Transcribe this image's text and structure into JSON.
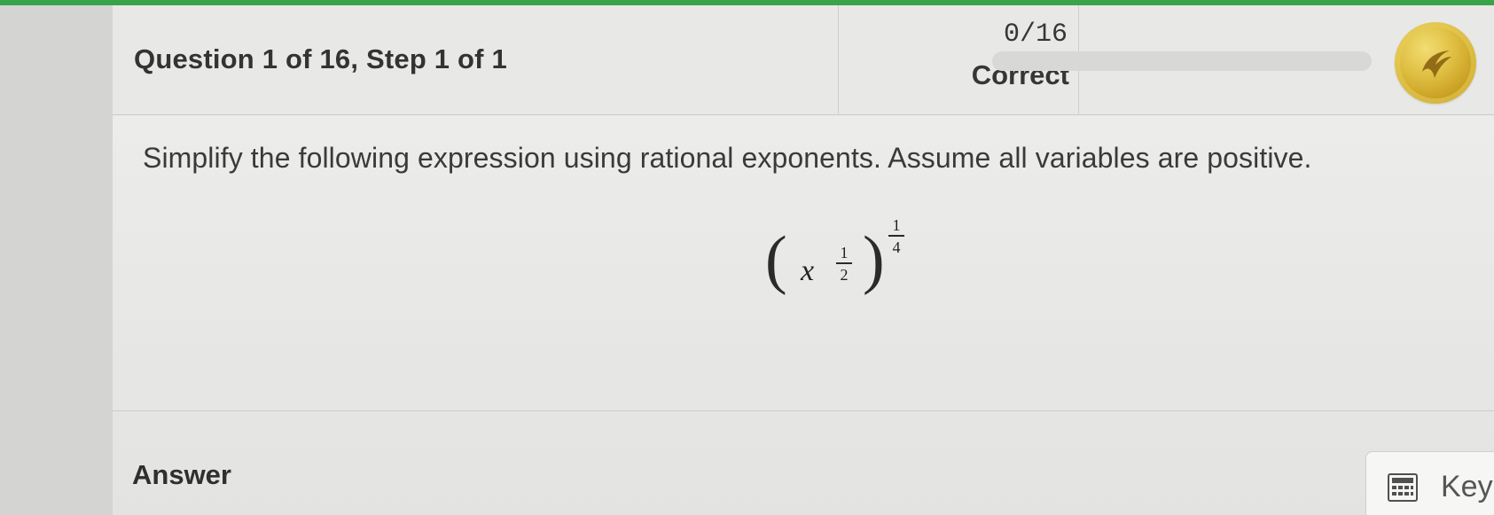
{
  "header": {
    "question_progress": "Question 1 of 16, Step 1 of 1",
    "score": "0/16",
    "score_label": "Correct",
    "progress_fraction": 0
  },
  "question": {
    "prompt": "Simplify the following expression using rational exponents. Assume all variables are positive.",
    "expression": {
      "left_paren": "(",
      "base": "x",
      "inner_exponent": {
        "numerator": "1",
        "denominator": "2"
      },
      "right_paren": ")",
      "outer_exponent": {
        "numerator": "1",
        "denominator": "4"
      }
    }
  },
  "answer": {
    "label": "Answer"
  },
  "keypad": {
    "label": "Key",
    "icon": "calculator-icon"
  },
  "icons": {
    "coin": "reward-coin-icon"
  },
  "colors": {
    "top_accent": "#39a34a",
    "coin_gold": "#d8b43a"
  }
}
